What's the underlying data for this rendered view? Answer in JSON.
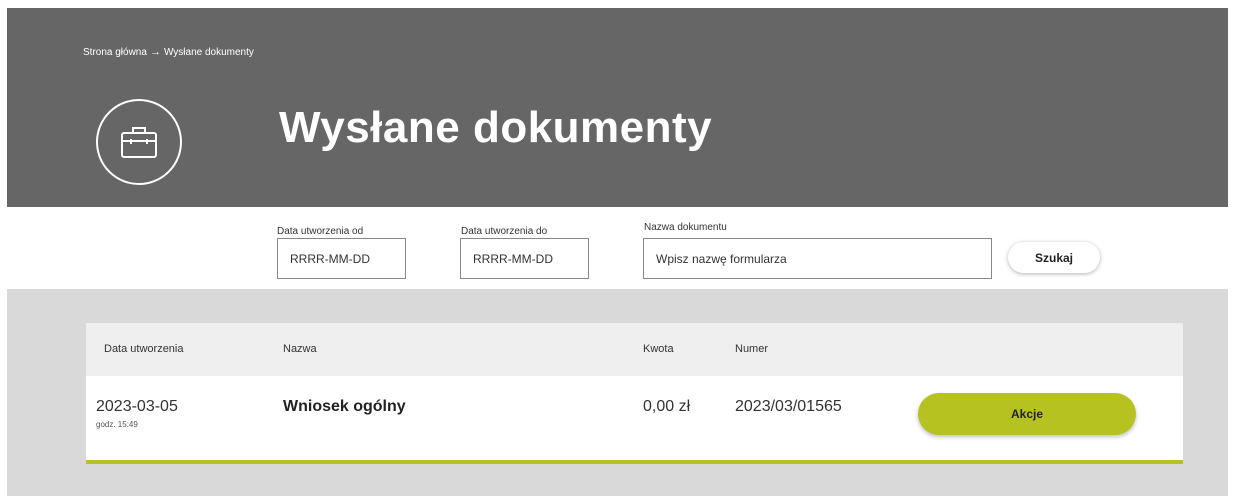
{
  "breadcrumb": {
    "home": "Strona główna",
    "separator": "→",
    "current": "Wysłane dokumenty"
  },
  "header": {
    "icon": "briefcase-icon",
    "title": "Wysłane dokumenty"
  },
  "filters": {
    "date_from": {
      "label": "Data utworzenia od",
      "placeholder": "RRRR-MM-DD",
      "value": ""
    },
    "date_to": {
      "label": "Data utworzenia do",
      "placeholder": "RRRR-MM-DD",
      "value": ""
    },
    "document_name": {
      "label": "Nazwa dokumentu",
      "placeholder": "Wpisz nazwę formularza",
      "value": ""
    },
    "search_label": "Szukaj"
  },
  "table": {
    "columns": [
      "Data utworzenia",
      "Nazwa",
      "Kwota",
      "Numer"
    ],
    "rows": [
      {
        "date": "2023-03-05",
        "time": "godz. 15:49",
        "name": "Wniosek ogólny",
        "amount": "0,00 zł",
        "number": "2023/03/01565",
        "action_label": "Akcje"
      }
    ]
  },
  "colors": {
    "header_bg": "#666666",
    "accent": "#b5c21f",
    "results_bg": "#d9d9d9"
  }
}
